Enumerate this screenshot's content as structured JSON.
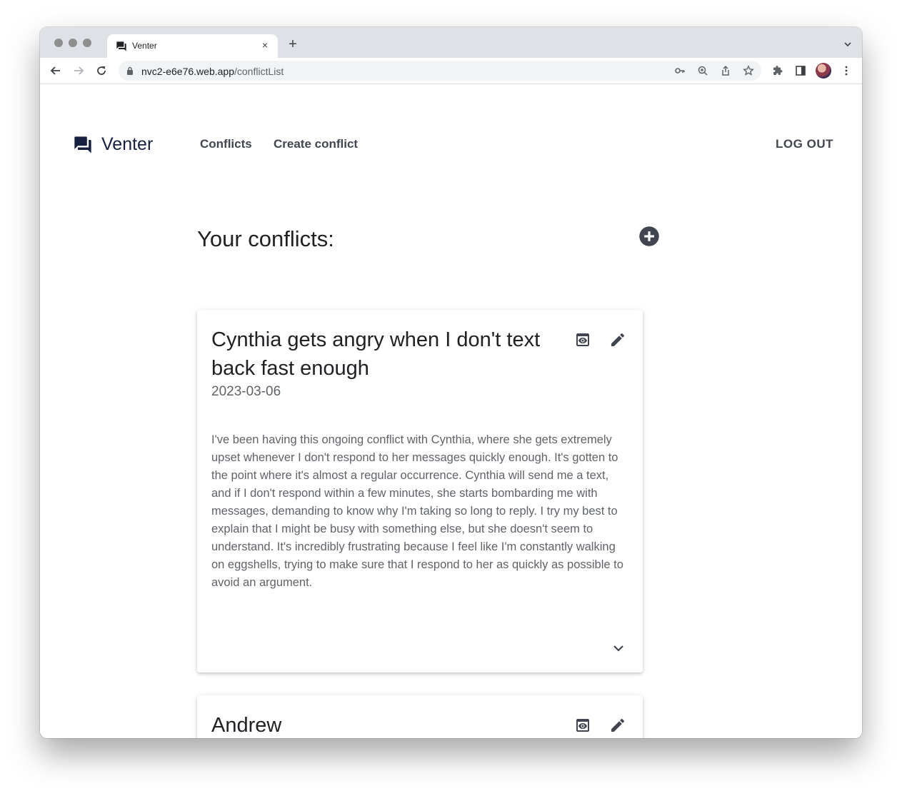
{
  "browser": {
    "tab_title": "Venter",
    "url_host": "nvc2-e6e76.web.app",
    "url_path": "/conflictList",
    "new_tab_label": "+",
    "close_tab_label": "×"
  },
  "app": {
    "brand": "Venter",
    "nav": {
      "conflicts": "Conflicts",
      "create": "Create conflict",
      "logout": "LOG OUT"
    },
    "heading": "Your conflicts:"
  },
  "conflicts": [
    {
      "title": "Cynthia gets angry when I don't text back fast enough",
      "date": "2023-03-06",
      "description": "I've been having this ongoing conflict with Cynthia, where she gets extremely upset whenever I don't respond to her messages quickly enough. It's gotten to the point where it's almost a regular occurrence. Cynthia will send me a text, and if I don't respond within a few minutes, she starts bombarding me with messages, demanding to know why I'm taking so long to reply. I try my best to explain that I might be busy with something else, but she doesn't seem to understand. It's incredibly frustrating because I feel like I'm constantly walking on eggshells, trying to make sure that I respond to her as quickly as possible to avoid an argument."
    },
    {
      "title": "Andrew"
    }
  ],
  "colors": {
    "brand": "#17213f",
    "icon": "#40454f",
    "text_secondary": "#5f6368"
  }
}
